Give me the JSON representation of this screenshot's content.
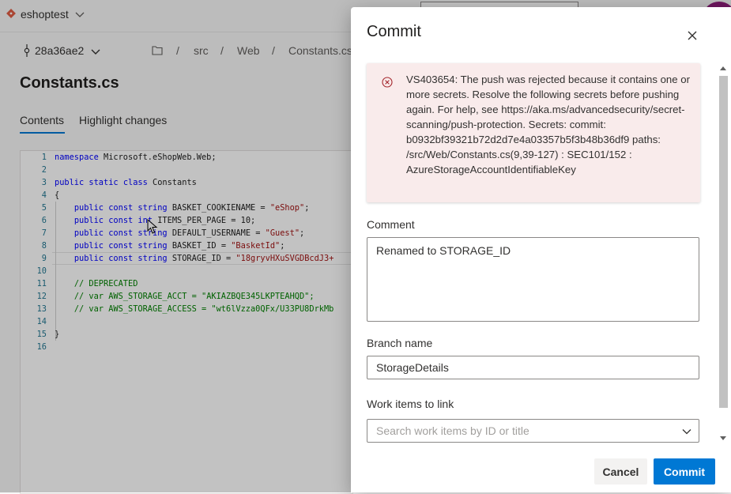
{
  "repo": {
    "name": "eshoptest"
  },
  "commit": {
    "id": "28a36ae2"
  },
  "breadcrumb": [
    "/",
    "src",
    "/",
    "Web",
    "/",
    "Constants.cs"
  ],
  "file": {
    "title": "Constants.cs"
  },
  "tabs": [
    {
      "label": "Contents",
      "active": true
    },
    {
      "label": "Highlight changes",
      "active": false
    }
  ],
  "code": {
    "line_numbers": [
      "1",
      "2",
      "3",
      "4",
      "5",
      "6",
      "7",
      "8",
      "9",
      "10",
      "11",
      "12",
      "13",
      "14",
      "15",
      "16"
    ]
  },
  "dialog": {
    "title": "Commit",
    "error": "VS403654: The push was rejected because it contains one or more secrets. Resolve the following secrets before pushing again. For help, see https://aka.ms/advancedsecurity/secret-scanning/push-protection. Secrets: commit: b0932bf39321b72d2d7e4a03357b5f3b48b36df9 paths: /src/Web/Constants.cs(9,39-127) : SEC101/152 : AzureStorageAccountIdentifiableKey",
    "comment_label": "Comment",
    "comment_value": "Renamed to STORAGE_ID",
    "branch_label": "Branch name",
    "branch_value": "StorageDetails",
    "work_items_label": "Work items to link",
    "work_items_placeholder": "Search work items by ID or title",
    "cancel_label": "Cancel",
    "commit_label": "Commit"
  },
  "colors": {
    "accent": "#0078d4",
    "error_bg": "#f9ebeb",
    "error_icon": "#a4262c",
    "repo_icon": "#e05d44",
    "avatar": "#8e1d7b"
  }
}
